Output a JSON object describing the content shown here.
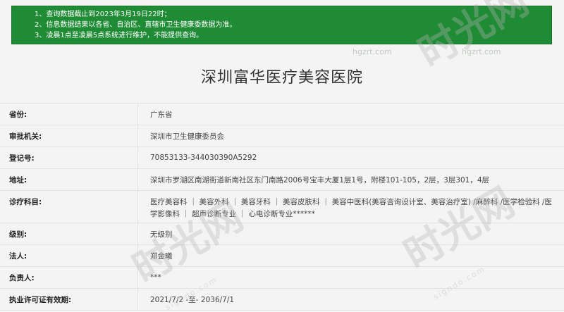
{
  "notice": {
    "lines": [
      "1、查询数据截止到2023年3月19日22时；",
      "2、信息数据结果以各省、自治区、直辖市卫生健康委数据为准。",
      "3、凌晨1点至凌晨5点系统进行维护，不能提供查询。"
    ]
  },
  "watermark": {
    "site": "hgzrt.com",
    "brand": "时光网",
    "brand_url": "signdo.com"
  },
  "page_title": "深圳富华医疗美容医院",
  "fields": [
    {
      "label": "省份:",
      "value": "广东省"
    },
    {
      "label": "审批机关:",
      "value": "深圳市卫生健康委员会"
    },
    {
      "label": "登记号:",
      "value": "70853133-344030390A5292"
    },
    {
      "label": "地址:",
      "value": "深圳市罗湖区南湖街道新南社区东门南路2006号宝丰大厦1层1号，附楼101-105，2层，3层301，4层"
    },
    {
      "label": "诊疗科目:",
      "value": "医疗美容科 ｜ 美容外科 ｜ 美容牙科 ｜ 美容皮肤科 ｜ 美容中医科(美容咨询设计室、美容治疗室) /麻醉科 /医学检验科 /医学影像科 ｜ 超声诊断专业 ｜ 心电诊断专业******"
    },
    {
      "label": "级别:",
      "value": "无级别"
    },
    {
      "label": "法人:",
      "value": "郑金曦"
    },
    {
      "label": "负责人:",
      "value": "***"
    },
    {
      "label": "执业许可证有效期:",
      "value": "2021/7/2 -至- 2036/7/1"
    }
  ]
}
